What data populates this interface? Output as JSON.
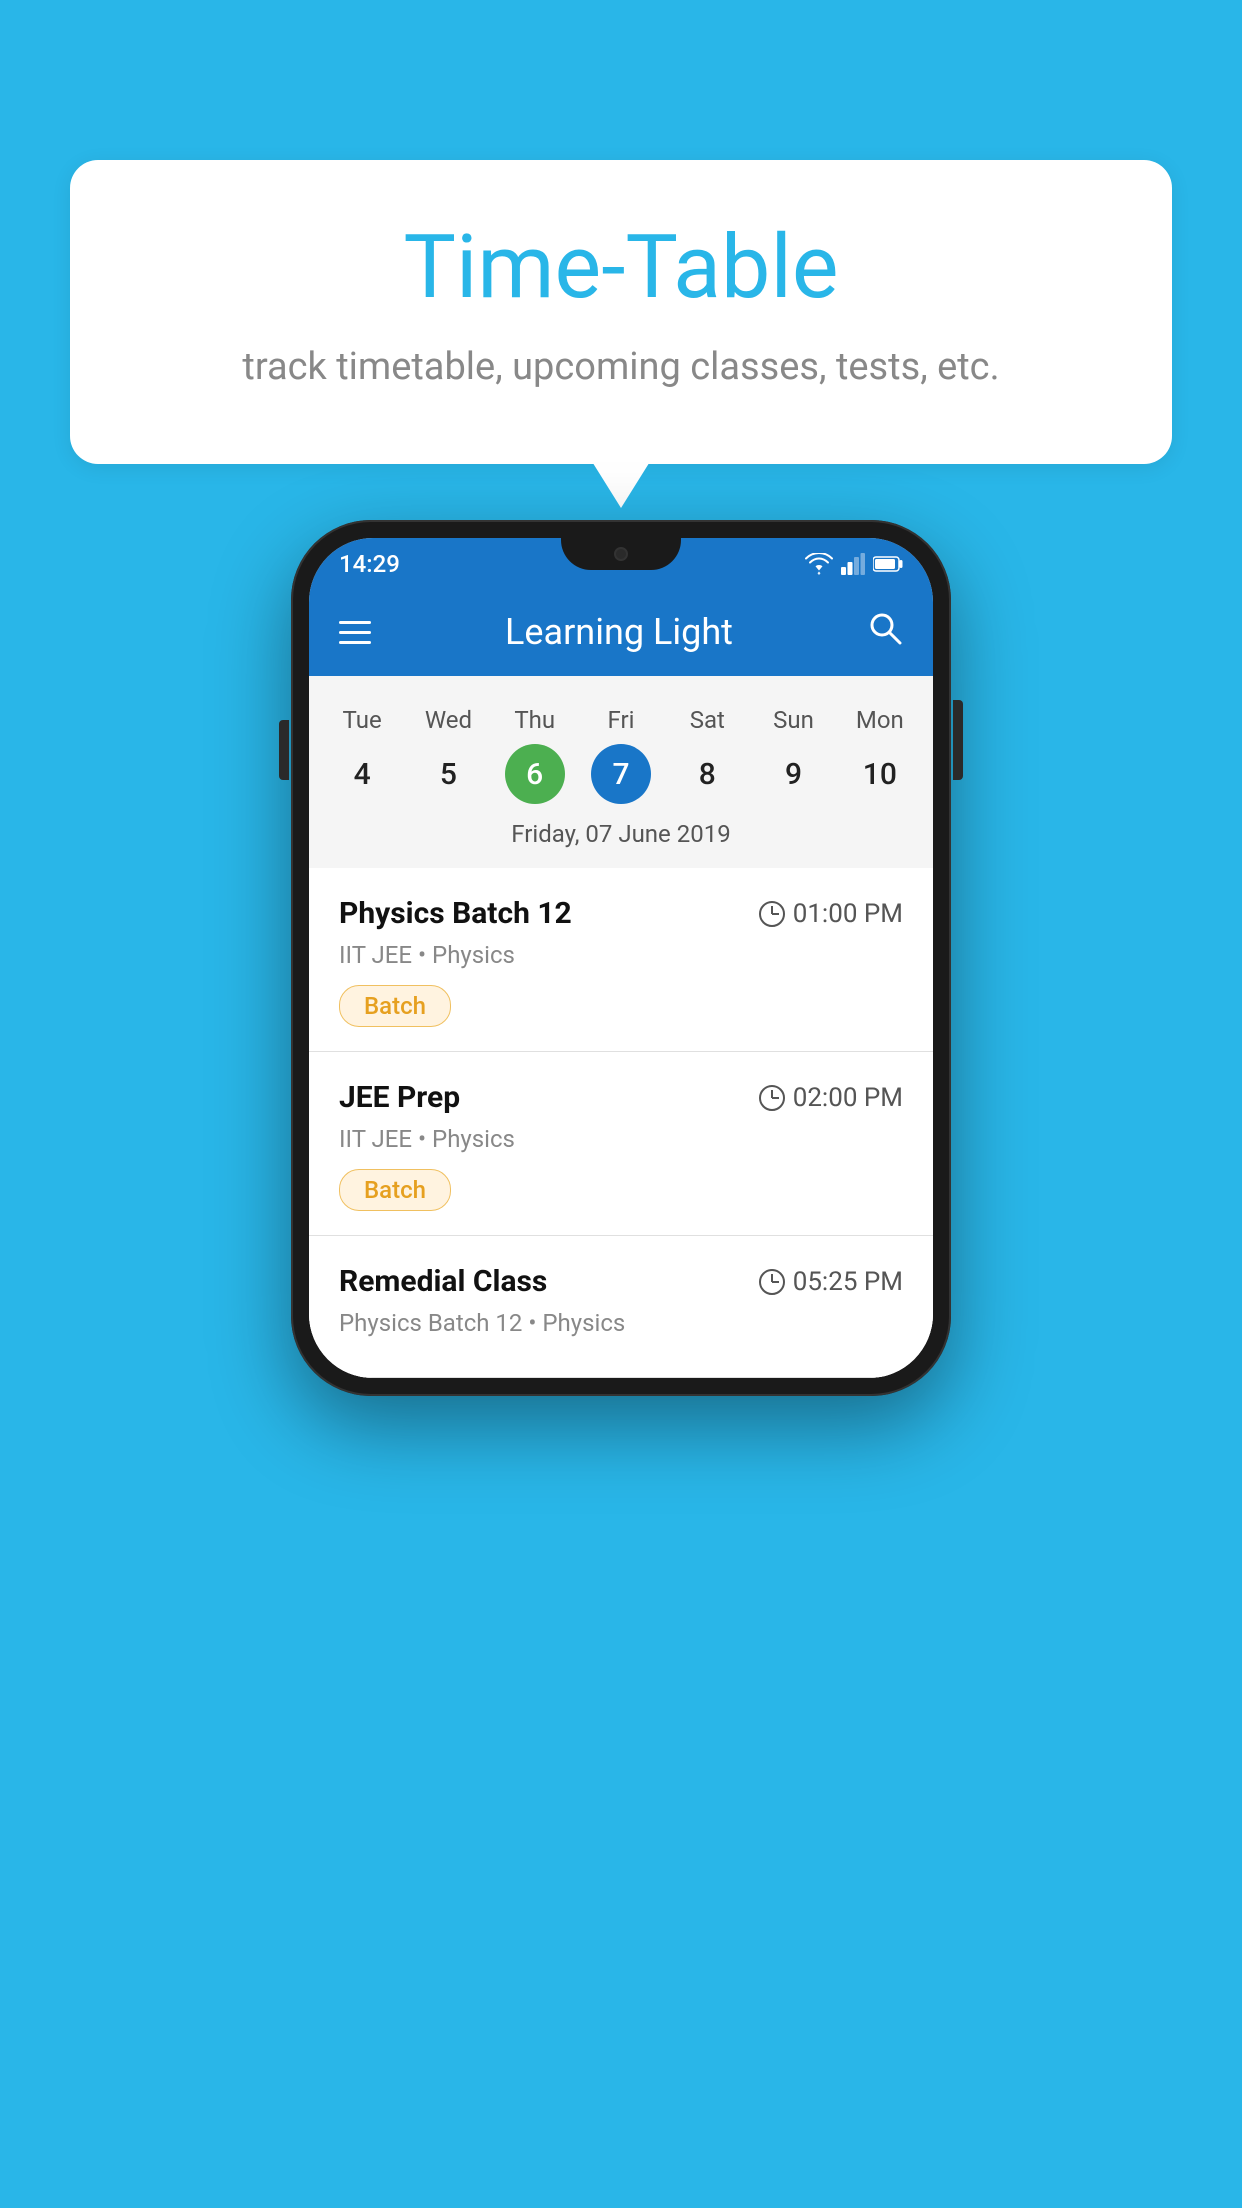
{
  "page": {
    "background_color": "#29B6E8"
  },
  "speech_bubble": {
    "title": "Time-Table",
    "subtitle": "track timetable, upcoming classes, tests, etc."
  },
  "app_bar": {
    "title": "Learning Light",
    "hamburger_label": "Menu",
    "search_label": "Search"
  },
  "status_bar": {
    "time": "14:29"
  },
  "calendar": {
    "days": [
      {
        "name": "Tue",
        "number": "4",
        "state": "normal"
      },
      {
        "name": "Wed",
        "number": "5",
        "state": "normal"
      },
      {
        "name": "Thu",
        "number": "6",
        "state": "today"
      },
      {
        "name": "Fri",
        "number": "7",
        "state": "selected"
      },
      {
        "name": "Sat",
        "number": "8",
        "state": "normal"
      },
      {
        "name": "Sun",
        "number": "9",
        "state": "normal"
      },
      {
        "name": "Mon",
        "number": "10",
        "state": "normal"
      }
    ],
    "selected_date_label": "Friday, 07 June 2019"
  },
  "schedule": {
    "items": [
      {
        "title": "Physics Batch 12",
        "time": "01:00 PM",
        "subject": "IIT JEE • Physics",
        "badge": "Batch"
      },
      {
        "title": "JEE Prep",
        "time": "02:00 PM",
        "subject": "IIT JEE • Physics",
        "badge": "Batch"
      },
      {
        "title": "Remedial Class",
        "time": "05:25 PM",
        "subject": "Physics Batch 12 • Physics",
        "badge": null
      }
    ]
  }
}
